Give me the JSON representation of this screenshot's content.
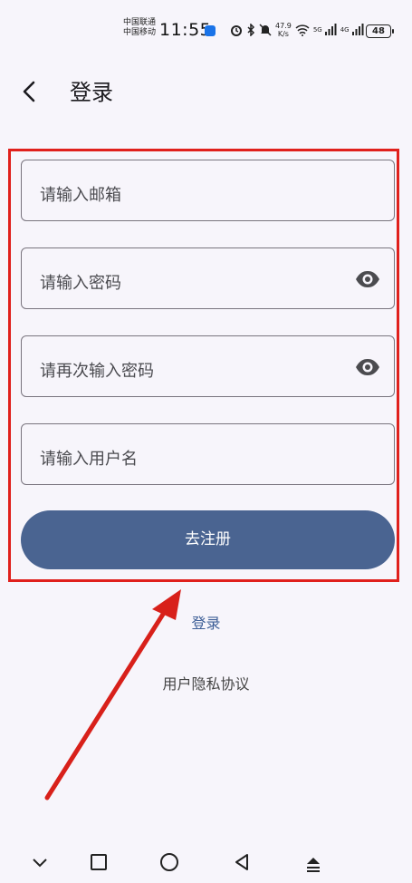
{
  "status_bar": {
    "carrier_1": "中国联通",
    "carrier_2": "中国移动",
    "time": "11:55",
    "speed_value": "47.9",
    "speed_unit": "K/s",
    "net_1": "5G",
    "net_2": "4G",
    "battery": "48"
  },
  "header": {
    "title": "登录"
  },
  "form": {
    "email_placeholder": "请输入邮箱",
    "password_placeholder": "请输入密码",
    "confirm_placeholder": "请再次输入密码",
    "username_placeholder": "请输入用户名",
    "submit_label": "去注册"
  },
  "links": {
    "login": "登录",
    "privacy": "用户隐私协议"
  },
  "colors": {
    "primary": "#4a6491",
    "annotation": "#e0201c",
    "background": "#f7f5fb"
  }
}
